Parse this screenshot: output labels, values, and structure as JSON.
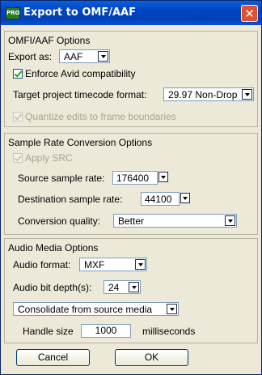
{
  "window": {
    "title": "Export to OMF/AAF",
    "app_icon_text": "PRO"
  },
  "omf": {
    "header": "OMFI/AAF Options",
    "export_as_label": "Export as:",
    "export_as_value": "AAF",
    "enforce_avid_label": "Enforce Avid compatibility",
    "enforce_avid_checked": true,
    "timecode_label": "Target project timecode format:",
    "timecode_value": "29.97 Non-Drop",
    "quantize_label": "Quantize edits to frame boundaries",
    "quantize_checked": true,
    "quantize_enabled": false
  },
  "src": {
    "header": "Sample Rate Conversion Options",
    "apply_label": "Apply SRC",
    "apply_checked": true,
    "apply_enabled": false,
    "source_rate_label": "Source sample rate:",
    "source_rate_value": "176400",
    "dest_rate_label": "Destination sample rate:",
    "dest_rate_value": "44100",
    "quality_label": "Conversion quality:",
    "quality_value": "Better"
  },
  "audio": {
    "header": "Audio Media Options",
    "format_label": "Audio format:",
    "format_value": "MXF",
    "bitdepth_label": "Audio bit depth(s):",
    "bitdepth_value": "24",
    "consolidate_value": "Consolidate from source media",
    "handle_label": "Handle size",
    "handle_value": "1000",
    "handle_unit": "milliseconds"
  },
  "buttons": {
    "cancel": "Cancel",
    "ok": "OK",
    "close_glyph": "✕"
  }
}
